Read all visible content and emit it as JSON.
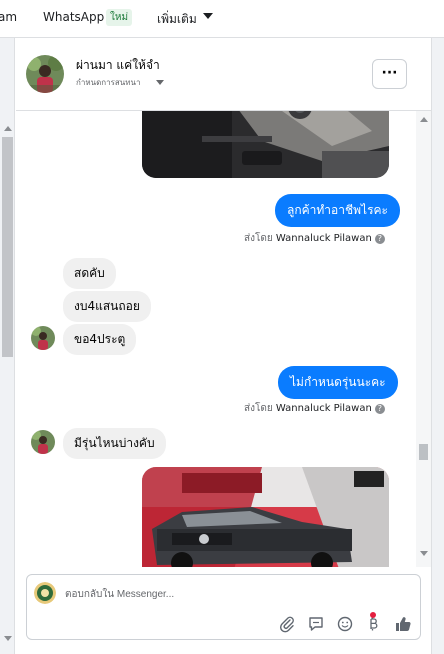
{
  "topnav": {
    "tab_partial": "am",
    "tab_whatsapp": "WhatsApp",
    "badge_new": "ใหม่",
    "tab_more": "เพิ่มเติม"
  },
  "chat": {
    "contact_name": "ผ่านมา แค่ให้จำ",
    "contact_sub": "กำหนดการสนทนา",
    "more_label": "···",
    "messages": {
      "out1": "ลูกค้าทำอาชีพไรคะ",
      "sent_by_prefix": "ส่งโดย",
      "sent_by_name": "Wannaluck Pilawan",
      "in1": "สดคับ",
      "in2": "งบ4แสนถอย",
      "in3": "ขอ4ประตู",
      "out2": "ไม่กำหนดรุ่นนะคะ",
      "in4": "มีรุ่นไหนบ่างคับ",
      "help_glyph": "?"
    },
    "composer": {
      "placeholder": "ตอบกลับใน Messenger..."
    }
  },
  "colors": {
    "outgoing_bubble": "#0a7cff",
    "incoming_bubble": "#f0f0f0",
    "notification_dot": "#e41e3f"
  }
}
